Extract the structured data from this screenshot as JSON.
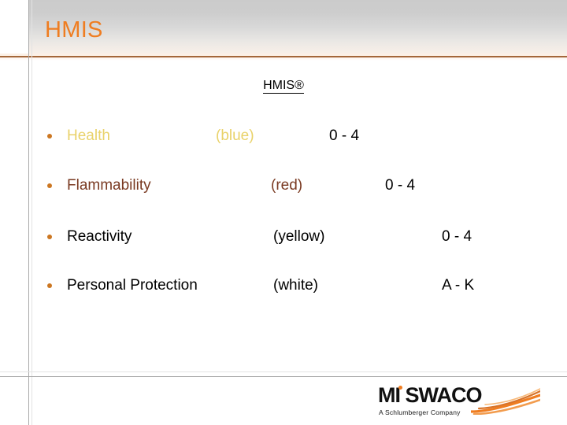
{
  "slide": {
    "title": "HMIS",
    "subheading": "HMIS®"
  },
  "colors": {
    "title_orange": "#ef7d21",
    "rule_brown": "#a4673a",
    "bullet_orange": "#cc7722",
    "row1_text": "#e9d26a",
    "row2_text": "#7a3a22",
    "row_default_text": "#000000",
    "logo_orange": "#ef7d21"
  },
  "rows": [
    {
      "bullet": "•",
      "label": "Health",
      "color_name": "(blue)",
      "range": "0 - 4",
      "text_color": "#e9d26a"
    },
    {
      "bullet": "•",
      "label": "Flammability",
      "color_name": "(red)",
      "range": "0 - 4",
      "text_color": "#7a3a22"
    },
    {
      "bullet": "•",
      "label": "Reactivity",
      "color_name": "(yellow)",
      "range": "0 - 4",
      "text_color": "#000000"
    },
    {
      "bullet": "•",
      "label": "Personal Protection",
      "color_name": "(white)",
      "range": "A - K",
      "text_color": "#000000"
    }
  ],
  "logo": {
    "wordmark": "MI SWACO",
    "tagline": "A Schlumberger Company"
  }
}
